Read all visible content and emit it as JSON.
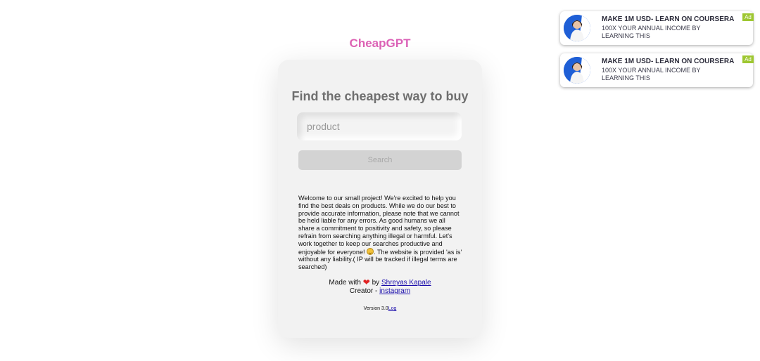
{
  "brand": "CheapGPT",
  "card": {
    "headline": "Find the cheapest way to buy",
    "search_placeholder": "product",
    "search_button": "Search",
    "welcome_part1": "Welcome to our small project! We're excited to help you find the best deals on products. While we do our best to provide accurate information, please note that we cannot be held liable for any errors. As good humans we all share a commitment to positivity and safety, so please refrain from searching anything illegal or harmful. Let's work together to keep our searches productive and enjoyable for everyone!",
    "welcome_part2": ". The website is provided 'as is' without any liability.( IP will be tracked if illegal terms are searched)",
    "made_with": "Made with",
    "by": "by",
    "author": "Shreyas Kapale",
    "creator_label": "Creator -",
    "instagram": "instagram",
    "version": "Version 3.0",
    "log": "Log"
  },
  "ads": [
    {
      "title": "MAKE 1M USD- LEARN ON COURSERA",
      "subtitle": "100X YOUR ANNUAL INCOME BY LEARNING THIS",
      "badge": "Ad"
    },
    {
      "title": "MAKE 1M USD- LEARN ON COURSERA",
      "subtitle": "100X YOUR ANNUAL INCOME BY LEARNING THIS",
      "badge": "Ad"
    }
  ],
  "colors": {
    "brand_gradient_start": "#f06292",
    "brand_gradient_end": "#c85fd8",
    "ad_badge": "#9ec731",
    "link": "#1a0dab"
  }
}
